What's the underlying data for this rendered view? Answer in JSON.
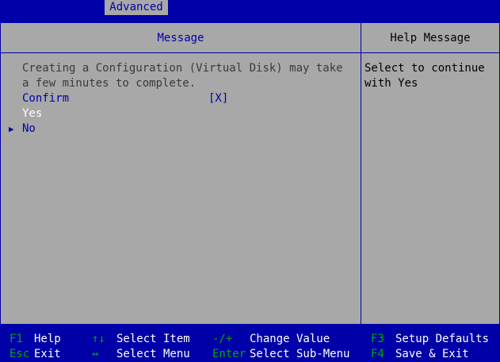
{
  "tabs": {
    "active_label": "Advanced"
  },
  "left_panel": {
    "header": "Message",
    "message_lines": [
      "Creating a Configuration (Virtual Disk) may take",
      "a few minutes to complete."
    ],
    "confirm_label": "Confirm",
    "confirm_value": "[X]",
    "options": [
      "Yes",
      "No"
    ]
  },
  "right_panel": {
    "header": "Help Message",
    "help_lines": [
      "Select to continue",
      "with Yes"
    ]
  },
  "footer": {
    "f1_key": "F1",
    "f1_desc": "Help",
    "esc_key": "Esc",
    "esc_desc": "Exit",
    "updown_key": "↑↓",
    "updown_desc": "Select Item",
    "lr_key": "↔",
    "lr_desc": "Select Menu",
    "pm_key": "-/+",
    "pm_desc": "Change Value",
    "enter_key": "Enter",
    "enter_desc": "Select Sub-Menu",
    "f3_key": "F3",
    "f3_desc": "Setup Defaults",
    "f4_key": "F4",
    "f4_desc": "Save & Exit"
  },
  "colors": {
    "background": "#0000a8",
    "panel": "#a8a8a8",
    "key_green": "#00a800"
  },
  "icons": {
    "selection_marker": "right-triangle-icon"
  }
}
